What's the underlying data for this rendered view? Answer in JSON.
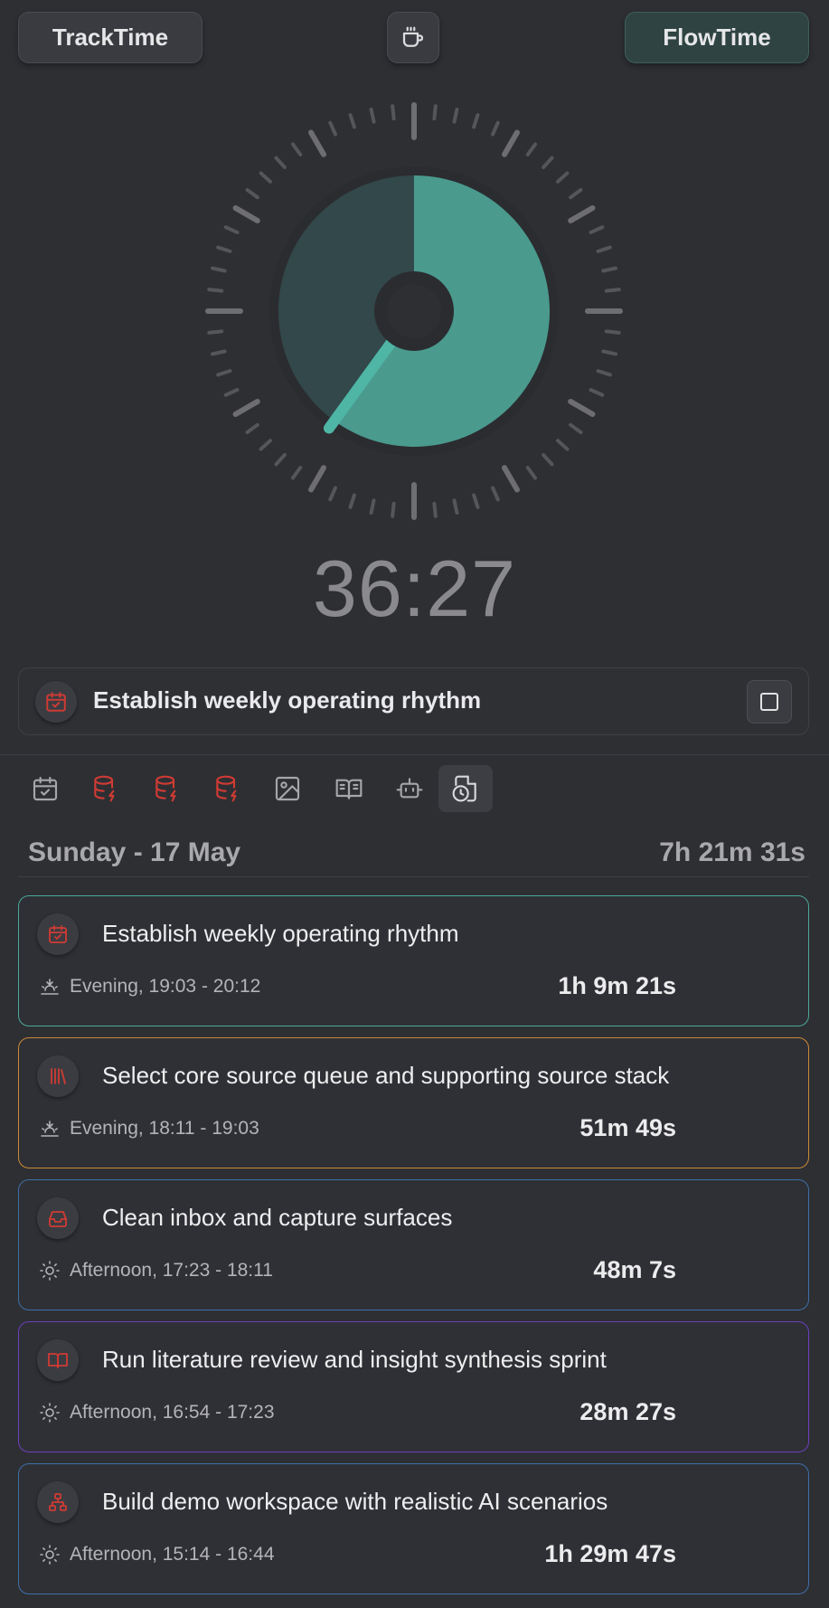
{
  "header": {
    "left_button": "TrackTime",
    "center_button_icon": "coffee-cup-icon",
    "right_button": "FlowTime"
  },
  "timer": {
    "display": "36:27",
    "progress_fraction": 0.6
  },
  "current_task": {
    "icon": "calendar-check-icon",
    "title": "Establish weekly operating rhythm"
  },
  "toolbar": {
    "items": [
      {
        "icon": "calendar-check-icon",
        "color": "#a7a7ab",
        "active": false
      },
      {
        "icon": "database-bolt-icon",
        "color": "#d03b34",
        "active": false
      },
      {
        "icon": "database-bolt-icon",
        "color": "#d03b34",
        "active": false
      },
      {
        "icon": "database-bolt-icon",
        "color": "#d03b34",
        "active": false
      },
      {
        "icon": "image-icon",
        "color": "#a7a7ab",
        "active": false
      },
      {
        "icon": "book-open-icon",
        "color": "#a7a7ab",
        "active": false
      },
      {
        "icon": "robot-icon",
        "color": "#a7a7ab",
        "active": false
      },
      {
        "icon": "file-clock-icon",
        "color": "#d8d8dc",
        "active": true
      }
    ]
  },
  "day": {
    "label": "Sunday - 17 May",
    "total": "7h 21m 31s"
  },
  "entries": [
    {
      "title": "Establish weekly operating rhythm",
      "period": "Evening, 19:03 - 20:12",
      "duration": "1h 9m 21s",
      "border": "#4aa89a",
      "icon": "calendar-check-icon",
      "time_icon": "sunset-icon"
    },
    {
      "title": "Select core source queue and supporting source stack",
      "period": "Evening, 18:11 - 19:03",
      "duration": "51m 49s",
      "border": "#c98a37",
      "icon": "library-icon",
      "time_icon": "sunset-icon"
    },
    {
      "title": "Clean inbox and capture surfaces",
      "period": "Afternoon, 17:23 - 18:11",
      "duration": "48m 7s",
      "border": "#3e6fa8",
      "icon": "inbox-icon",
      "time_icon": "sun-icon"
    },
    {
      "title": "Run literature review and insight synthesis sprint",
      "period": "Afternoon, 16:54 - 17:23",
      "duration": "28m 27s",
      "border": "#6b3fbf",
      "icon": "book-open-icon",
      "time_icon": "sun-icon"
    },
    {
      "title": "Build demo workspace with realistic AI scenarios",
      "period": "Afternoon, 15:14 - 16:44",
      "duration": "1h 29m 47s",
      "border": "#3e6fa8",
      "icon": "sitemap-icon",
      "time_icon": "sun-icon"
    }
  ],
  "colors": {
    "accent_teal": "#4a9a8e",
    "icon_red": "#d03b34"
  }
}
